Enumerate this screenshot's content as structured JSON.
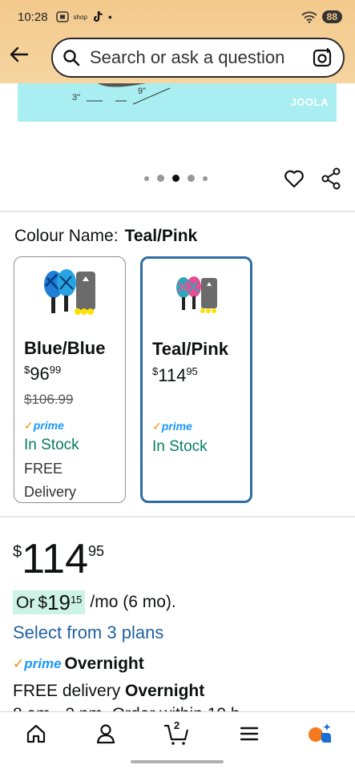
{
  "status_bar": {
    "time": "10:28",
    "shop_label": "shop",
    "battery": "88"
  },
  "search": {
    "placeholder": "Search or ask a question"
  },
  "product_image": {
    "dim_a": "3\"",
    "dim_b": "9\"",
    "brand_logo": "JOOLA"
  },
  "carousel": {
    "dot_count": 5,
    "active_index": 2
  },
  "colour": {
    "label": "Colour Name:",
    "selected": "Teal/Pink"
  },
  "variants": [
    {
      "name": "Blue/Blue",
      "currency": "$",
      "price_whole": "96",
      "price_fraction": "99",
      "was_price": "$106.99",
      "prime": "prime",
      "stock": "In Stock",
      "free": "FREE",
      "delivery": "Delivery"
    },
    {
      "name": "Teal/Pink",
      "currency": "$",
      "price_whole": "114",
      "price_fraction": "95",
      "prime": "prime",
      "stock": "In Stock"
    }
  ],
  "price": {
    "currency": "$",
    "whole": "114",
    "fraction": "95"
  },
  "monthly": {
    "prefix": "Or",
    "currency": "$",
    "whole": "19",
    "fraction": "15",
    "suffix": "/mo (6 mo)."
  },
  "plans_link": "Select from 3 plans",
  "prime_overnight": {
    "prime": "prime",
    "label": "Overnight"
  },
  "free_delivery": {
    "text": "FREE delivery",
    "speed": "Overnight"
  },
  "cutoff_text": "8 am - 2 pm. Order within 10 h",
  "bottom_nav": {
    "cart_count": "2"
  },
  "colors": {
    "header": "#f3c98c",
    "link": "#2162a1",
    "stock": "#067d62",
    "prime": "#1a98ff",
    "selected_border": "#2e6da4",
    "emi_highlight": "#cdf2e6"
  }
}
